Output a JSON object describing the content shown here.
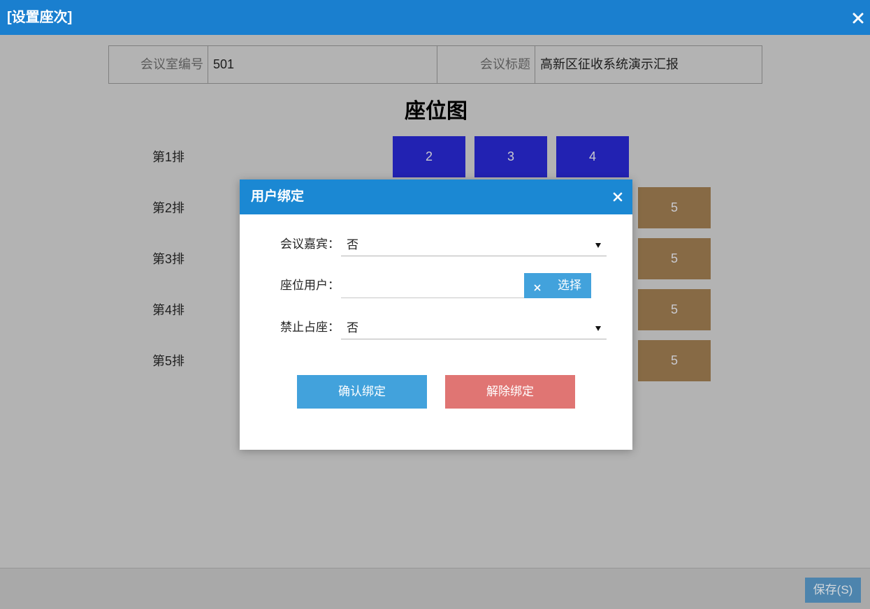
{
  "window": {
    "title": "[设置座次]",
    "close_icon": "close-icon"
  },
  "info": {
    "room_label": "会议室编号",
    "room_value": "501",
    "title_label": "会议标题",
    "title_value": "高新区征收系统演示汇报"
  },
  "seat_map": {
    "title": "座位图",
    "rows": [
      {
        "label": "第1排",
        "seats": [
          "2",
          "3",
          "4"
        ]
      },
      {
        "label": "第2排",
        "seats": [
          "5"
        ]
      },
      {
        "label": "第3排",
        "seats": [
          "5"
        ]
      },
      {
        "label": "第4排",
        "seats": [
          "5"
        ]
      },
      {
        "label": "第5排",
        "seats": [
          "5"
        ]
      }
    ]
  },
  "footer": {
    "save_label": "保存(S)"
  },
  "dialog": {
    "title": "用户绑定",
    "close_icon": "close-icon",
    "guest": {
      "label": "会议嘉宾：",
      "value": "否",
      "icon": "dropdown-arrow-icon"
    },
    "seat_user": {
      "label": "座位用户：",
      "value": "",
      "clear_icon": "clear-icon",
      "select_label": "选择"
    },
    "forbid": {
      "label": "禁止占座：",
      "value": "否",
      "icon": "dropdown-arrow-icon"
    },
    "confirm_label": "确认绑定",
    "unbind_label": "解除绑定"
  },
  "colors": {
    "header": "#1a7fcf",
    "dialog_header": "#1b88d3",
    "seat_blue": "#2222b2",
    "seat_brown": "#876a45",
    "select_button": "#42a2dc",
    "confirm": "#42a2dc",
    "unbind": "#e07573",
    "save": "#4d84ad"
  }
}
